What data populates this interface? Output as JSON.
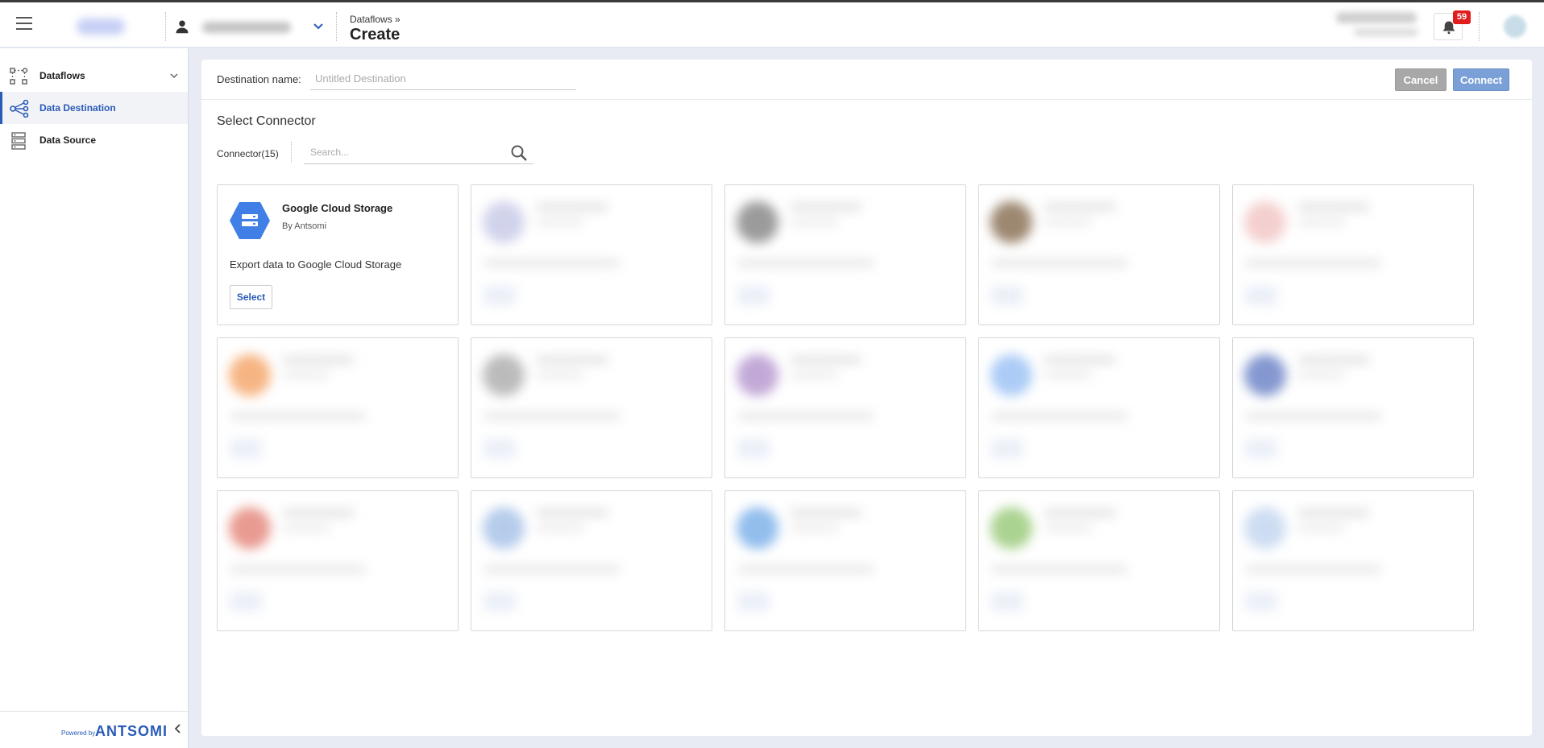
{
  "topbar": {
    "breadcrumb_parent": "Dataflows »",
    "page_title": "Create",
    "notification_count": "59",
    "icons": [
      "menu-icon",
      "user-icon",
      "chevron-down-icon",
      "bell-icon"
    ]
  },
  "sidebar": {
    "items": [
      {
        "label": "Dataflows",
        "icon": "dataflows-icon",
        "active": false
      },
      {
        "label": "Data Destination",
        "icon": "share-nodes-icon",
        "active": true
      },
      {
        "label": "Data Source",
        "icon": "database-icon",
        "active": false
      }
    ],
    "footer_powered": "Powered by",
    "footer_brand": "ANTSOMI"
  },
  "main": {
    "destination_label": "Destination name:",
    "destination_placeholder": "Untitled Destination",
    "cancel_label": "Cancel",
    "connect_label": "Connect",
    "section_title": "Select Connector",
    "connector_count": "Connector(15)",
    "search_placeholder": "Search..."
  },
  "cards": [
    {
      "title": "Google Cloud Storage",
      "by": "By Antsomi",
      "description": "Export data to Google Cloud Storage",
      "button": "Select",
      "color": "#3f7fe6"
    }
  ],
  "blurred_card_colors": [
    "#c9cbe8",
    "#8a8a8a",
    "#8c7358",
    "#f3c7c7",
    "#f5a86e",
    "#b0b0b0",
    "#b89ad0",
    "#9ec3f5",
    "#6f86c8",
    "#e58a7e",
    "#a9c3e8",
    "#7fb2ea",
    "#9ccb7d",
    "#c5d7f0"
  ]
}
